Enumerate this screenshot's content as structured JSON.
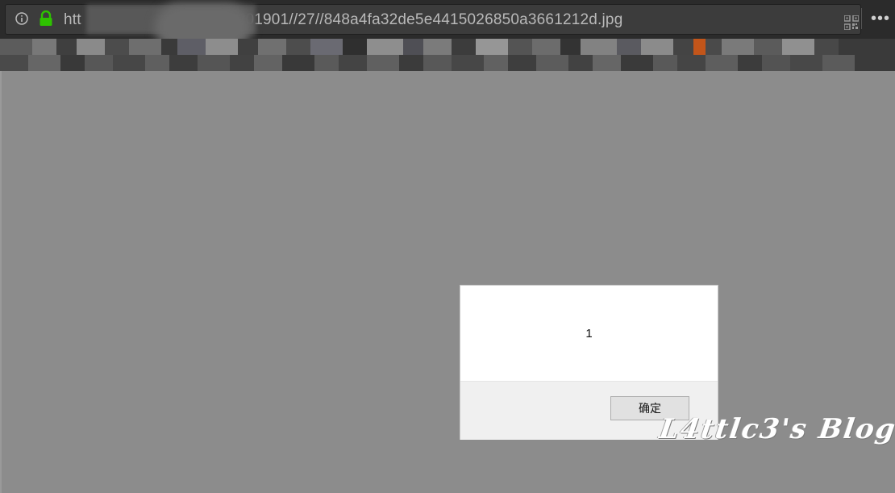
{
  "browser": {
    "url_visible_prefix": "htt",
    "url_visible_suffix": "201901//27//848a4fa32de5e4415026850a3661212d.jpg",
    "icons": [
      "info-icon",
      "lock-icon",
      "qr-code-icon",
      "more-icon"
    ],
    "more_label": "•••"
  },
  "dialog": {
    "message": "1",
    "ok_label": "确定"
  },
  "watermark": {
    "text": "L4ttlc3's Blog"
  },
  "colors": {
    "lock_green": "#2ec200",
    "page_overlay": "#8c8c8c",
    "toolbar": "#2b2b2b"
  }
}
